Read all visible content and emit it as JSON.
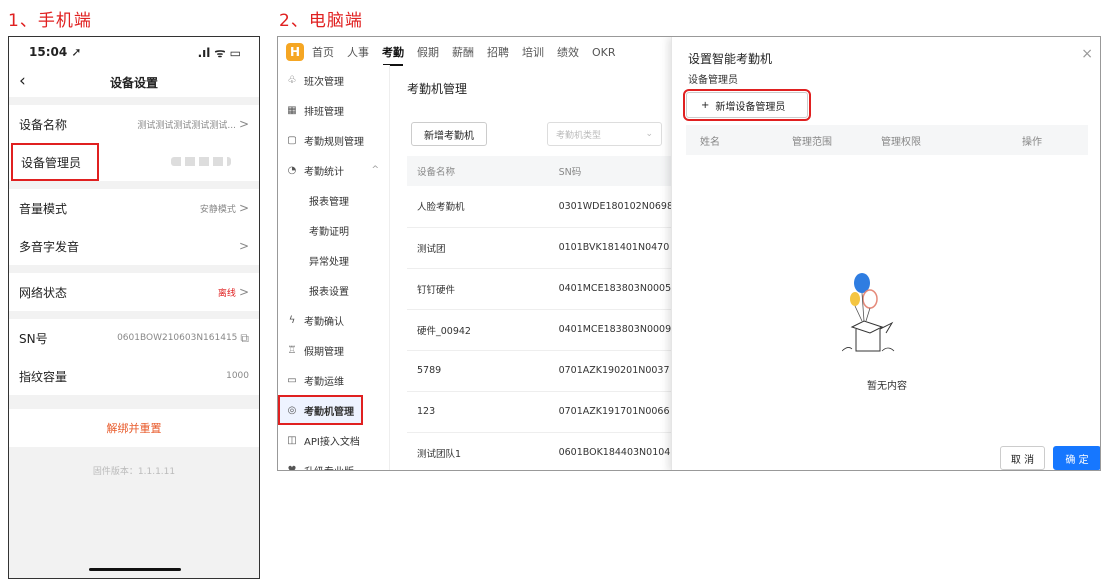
{
  "labels": {
    "phone_section": "1、手机端",
    "desktop_section": "2、电脑端"
  },
  "phone": {
    "status_time": "15:04 ➚",
    "status_icons": ".ıl ᯤ ▭",
    "back_icon": "‹",
    "nav_title": "设备设置",
    "rows": [
      {
        "label": "设备名称",
        "value": "测试测试测试测试测试...",
        "chevron": ">"
      },
      {
        "label": "设备管理员",
        "value": "",
        "chevron": ""
      },
      {
        "label": "音量模式",
        "value": "安静模式",
        "chevron": ">"
      },
      {
        "label": "多音字发音",
        "value": "",
        "chevron": ">"
      },
      {
        "label": "网络状态",
        "value": "离线",
        "chevron": ">"
      },
      {
        "label": "SN号",
        "value": "0601BOW210603N161415",
        "chevron": "⧉"
      },
      {
        "label": "指纹容量",
        "value": "1000",
        "chevron": ""
      }
    ],
    "unbind": "解绑并重置",
    "firmware": "固件版本：1.1.1.11",
    "offline_color": "#e02020"
  },
  "desktop": {
    "logo": "H",
    "tabs": [
      "首页",
      "人事",
      "考勤",
      "假期",
      "薪酬",
      "招聘",
      "培训",
      "绩效",
      "OKR"
    ],
    "active_tab": "考勤",
    "sidebar": [
      {
        "icon": "♧",
        "label": "班次管理"
      },
      {
        "icon": "▦",
        "label": "排班管理"
      },
      {
        "icon": "▢",
        "label": "考勤规则管理"
      },
      {
        "icon": "◔",
        "label": "考勤统计",
        "caret": "^"
      },
      {
        "icon": "",
        "label": "报表管理"
      },
      {
        "icon": "",
        "label": "考勤证明"
      },
      {
        "icon": "",
        "label": "异常处理"
      },
      {
        "icon": "",
        "label": "报表设置"
      },
      {
        "icon": "ϟ",
        "label": "考勤确认"
      },
      {
        "icon": "♖",
        "label": "假期管理"
      },
      {
        "icon": "▭",
        "label": "考勤运维"
      },
      {
        "icon": "◎",
        "label": "考勤机管理"
      },
      {
        "icon": "◫",
        "label": "API接入文档"
      },
      {
        "icon": "♥",
        "label": "升级专业版"
      }
    ],
    "main": {
      "title": "考勤机管理",
      "add_button": "新增考勤机",
      "type_placeholder": "考勤机类型",
      "columns": [
        "设备名称",
        "SN码"
      ],
      "rows": [
        [
          "人脸考勤机",
          "0301WDE180102N0698"
        ],
        [
          "测试团",
          "0101BVK181401N0470"
        ],
        [
          "钉钉硬件",
          "0401MCE183803N0005"
        ],
        [
          "硬件_00942",
          "0401MCE183803N0009"
        ],
        [
          "5789",
          "0701AZK190201N0037"
        ],
        [
          "123",
          "0701AZK191701N0066"
        ],
        [
          "测试团队1",
          "0601BOK184403N0104"
        ]
      ]
    },
    "modal": {
      "title": "设置智能考勤机",
      "close": "×",
      "section_label": "设备管理员",
      "add_admin": "新增设备管理员",
      "add_icon": "+",
      "columns": [
        "姓名",
        "管理范围",
        "管理权限",
        "操作"
      ],
      "empty": "暂无内容",
      "cancel": "取 消",
      "ok": "确 定",
      "accent": "#1677ff"
    }
  }
}
